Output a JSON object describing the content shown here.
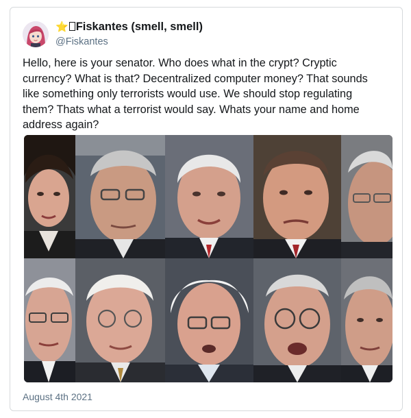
{
  "tweet": {
    "author": {
      "star_glyph": "⭐",
      "name": "Fiskantes (smell, smell)",
      "handle": "@Fiskantes",
      "avatar_icon": "anime-avatar-icon"
    },
    "text": "Hello, here is your senator. Who does what in the crypt? Cryptic currency? What is that? Decentralized computer money?  That sounds like something only terrorists would use. We should stop regulating them? Thats what a terrorist would say. Whats your name and home address again?",
    "date": "August 4th 2021",
    "photo_grid": {
      "rows": 2,
      "columns": 5
    }
  },
  "colors": {
    "text": "#14171a",
    "secondary_text": "#5b7083",
    "card_border": "#d6d9dc",
    "star": "#f5c242"
  }
}
